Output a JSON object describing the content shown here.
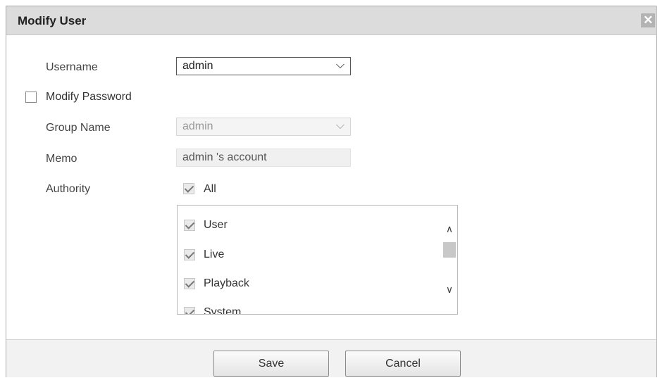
{
  "dialog": {
    "title": "Modify User",
    "close_icon": "close-icon"
  },
  "form": {
    "username_label": "Username",
    "username_value": "admin",
    "modify_password_label": "Modify Password",
    "modify_password_checked": false,
    "group_name_label": "Group Name",
    "group_name_value": "admin",
    "memo_label": "Memo",
    "memo_value": "admin 's account",
    "authority_label": "Authority",
    "all_label": "All",
    "all_checked": true
  },
  "authority_list": {
    "items": [
      {
        "label": "User",
        "checked": true
      },
      {
        "label": "Live",
        "checked": true
      },
      {
        "label": "Playback",
        "checked": true
      },
      {
        "label": "System",
        "checked": true
      }
    ]
  },
  "footer": {
    "save_label": "Save",
    "cancel_label": "Cancel"
  },
  "colors": {
    "titlebar_bg": "#dcdcdc",
    "footer_bg": "#f2f2f2",
    "close_bg": "#b3b3b3"
  }
}
